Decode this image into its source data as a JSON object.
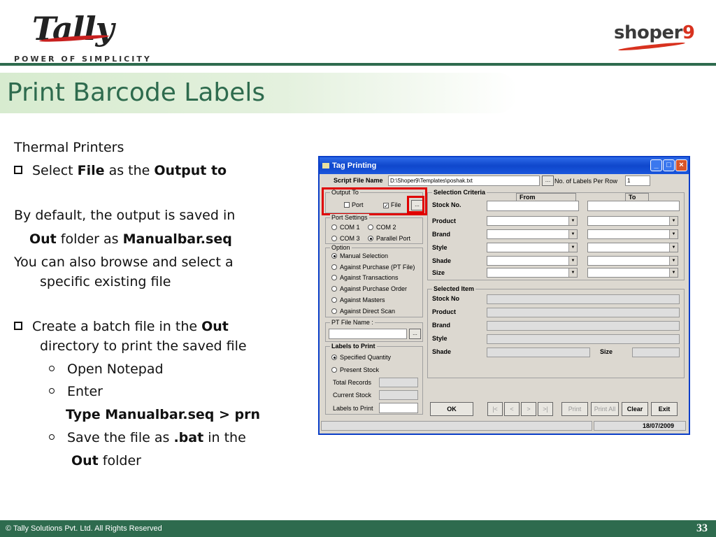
{
  "header": {
    "brand_left": "Tally",
    "tagline": "POWER OF SIMPLICITY",
    "brand_right_text": "shoper",
    "brand_right_num": "9",
    "title": "Print Barcode Labels"
  },
  "content": {
    "l1": "Thermal Printers",
    "l2_a": "Select ",
    "l2_b": "File",
    "l2_c": " as the ",
    "l2_d": "Output to",
    "l3": "By default, the output is saved in",
    "l4_a": "Out",
    "l4_b": " folder as ",
    "l4_c": "Manualbar.seq",
    "l5": "You can also browse and select a",
    "l6": "specific existing file",
    "l7_a": "Create a batch file in the ",
    "l7_b": "Out",
    "l8": "directory to print the saved file",
    "l9": "Open Notepad",
    "l10": "Enter",
    "l11": "Type Manualbar.seq > prn",
    "l12_a": "Save the file as ",
    "l12_b": ".bat",
    "l12_c": " in the",
    "l13_a": "Out",
    "l13_b": " folder"
  },
  "footer": {
    "copyright": "© Tally Solutions Pvt. Ltd. All Rights Reserved",
    "page": "33"
  },
  "window": {
    "title": "Tag Printing",
    "script_label": "Script File Name",
    "script_value": "D:\\Shoper9\\Templates\\poshak.txt",
    "labels_per_row_label": "No. of Labels Per Row",
    "labels_per_row_value": "1",
    "output_to": {
      "title": "Output To",
      "port": "Port",
      "file": "File",
      "browse": "..."
    },
    "port_settings": {
      "title": "Port Settings",
      "com1": "COM 1",
      "com2": "COM 2",
      "com3": "COM 3",
      "parallel": "Parallel Port"
    },
    "option": {
      "title": "Option",
      "items": [
        "Manual Selection",
        "Against Purchase (PT File)",
        "Against Transactions",
        "Against Purchase Order",
        "Against Masters",
        "Against Direct Scan"
      ]
    },
    "pt_file": {
      "title": "PT File Name :",
      "browse": "..."
    },
    "labels_to_print": {
      "title": "Labels to Print",
      "specified": "Specified Quantity",
      "present": "Present Stock",
      "total_records": "Total Records",
      "current_stock": "Current Stock",
      "labels_to_print": "Labels to Print"
    },
    "selection": {
      "title": "Selection Criteria",
      "from": "From",
      "to": "To",
      "rows": [
        "Stock No.",
        "Product",
        "Brand",
        "Style",
        "Shade",
        "Size"
      ]
    },
    "selected_item": {
      "title": "Selected Item",
      "stock_no": "Stock No",
      "product": "Product",
      "brand": "Brand",
      "style": "Style",
      "shade": "Shade",
      "size": "Size"
    },
    "buttons": {
      "ok": "OK",
      "first": "|<",
      "prev": "<",
      "next": ">",
      "last": ">|",
      "print": "Print",
      "print_all": "Print All",
      "clear": "Clear",
      "exit": "Exit"
    },
    "status_date": "18/07/2009"
  }
}
